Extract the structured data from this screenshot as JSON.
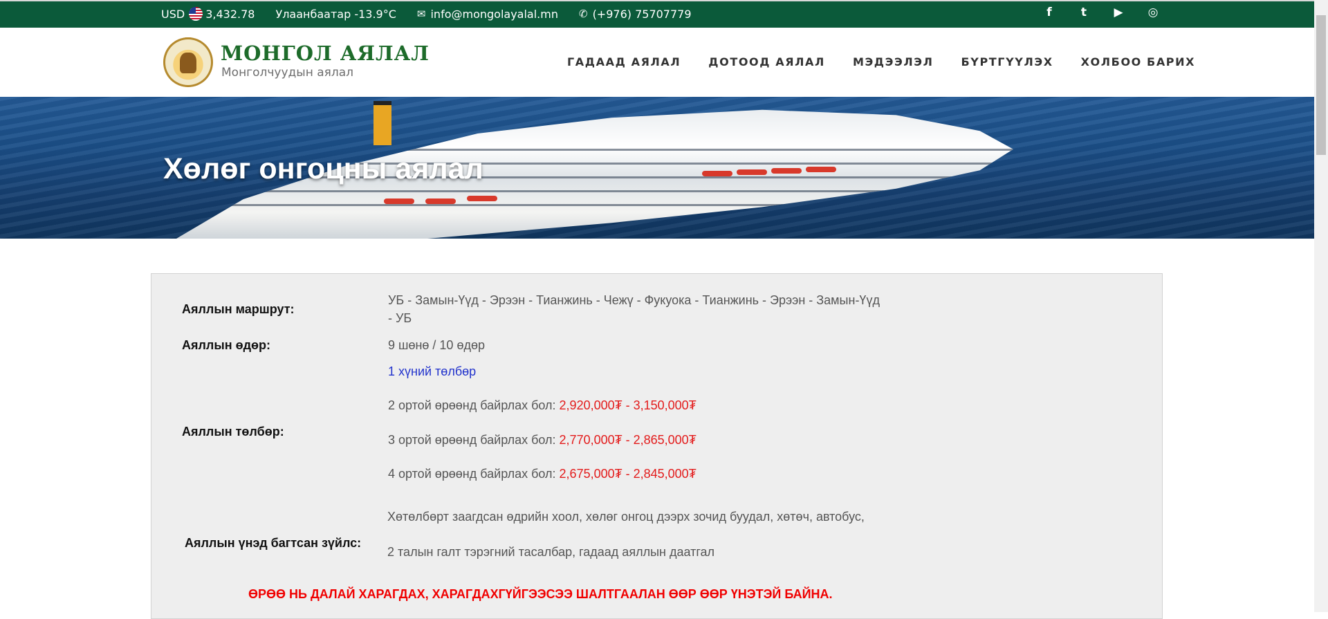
{
  "topbar": {
    "currency_label": "USD",
    "currency_rate": "3,432.78",
    "weather": "Улаанбаатар -13.9°C",
    "email": "info@mongolayalal.mn",
    "phone": "(+976) 75707779",
    "social": [
      {
        "icon": "facebook-icon",
        "glyph": "f"
      },
      {
        "icon": "twitter-icon",
        "glyph": "t"
      },
      {
        "icon": "youtube-icon",
        "glyph": "▶"
      },
      {
        "icon": "instagram-icon",
        "glyph": "◎"
      }
    ]
  },
  "header": {
    "logo_title": "МОНГОЛ АЯЛАЛ",
    "logo_subtitle": "Монголчуудын аялал",
    "nav": [
      "ГАДААД АЯЛАЛ",
      "ДОТООД АЯЛАЛ",
      "МЭДЭЭЛЭЛ",
      "БҮРТГҮҮЛЭХ",
      "ХОЛБОО БАРИХ"
    ]
  },
  "banner": {
    "title": "Хөлөг онгоцны аялал"
  },
  "details": {
    "route_label": "Аяллын маршрут:",
    "route_line1": "УБ - Замын-Үүд - Эрээн - Тианжинь - Чежү - Фукуока - Тианжинь - Эрээн - Замын-Үүд",
    "route_line2": "- УБ",
    "days_label": "Аяллын өдөр:",
    "days_value": "9 шөнө / 10 өдөр",
    "price_link": "1 хүний төлбөр",
    "price_label": "Аяллын төлбөр:",
    "prices": [
      {
        "text": "2 ортой өрөөнд байрлах бол: ",
        "range": "2,920,000₮ - 3,150,000₮"
      },
      {
        "text": "3 ортой өрөөнд байрлах бол: ",
        "range": "2,770,000₮ - 2,865,000₮"
      },
      {
        "text": "4 ортой өрөөнд байрлах бол: ",
        "range": "2,675,000₮ - 2,845,000₮"
      }
    ],
    "included_label": "Аяллын үнэд багтсан зүйлс:",
    "included_line1": "Хөтөлбөрт заагдсан өдрийн хоол, хөлөг онгоц дээрх зочид буудал, хөтөч, автобус,",
    "included_line2": "2 талын галт тэрэгний тасалбар, гадаад аяллын даатгал",
    "notice": "ӨРӨӨ НЬ ДАЛАЙ ХАРАГДАХ, ХАРАГДАХГҮЙГЭЭСЭЭ ШАЛТГААЛАН ӨӨР ӨӨР ҮНЭТЭЙ БАЙНА."
  },
  "colors": {
    "topbar_bg": "#0b5a3a",
    "logo_green": "#1d6b2a",
    "price_red": "#e31b1b",
    "notice_red": "#f00000",
    "link_blue": "#2233cc"
  }
}
